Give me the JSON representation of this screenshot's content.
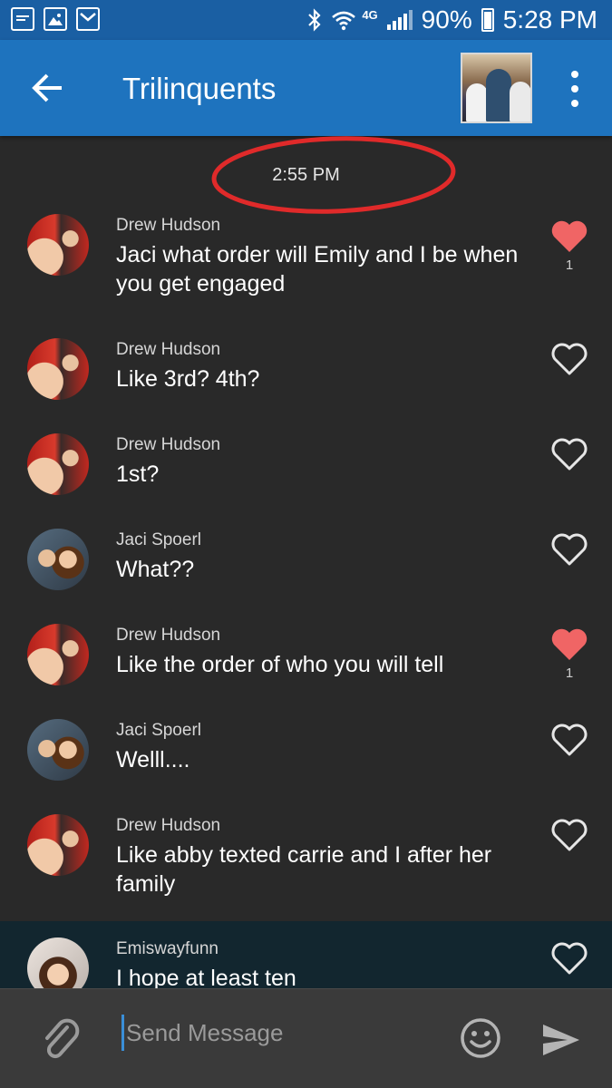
{
  "status_bar": {
    "network": "4G",
    "battery": "90%",
    "time": "5:28 PM"
  },
  "header": {
    "title": "Trilinquents"
  },
  "timestamp": "2:55 PM",
  "messages": [
    {
      "sender": "Drew Hudson",
      "text": "Jaci what order will Emily and I be when you get engaged",
      "liked": true,
      "likes": "1"
    },
    {
      "sender": "Drew Hudson",
      "text": "Like 3rd? 4th?",
      "liked": false,
      "likes": ""
    },
    {
      "sender": "Drew Hudson",
      "text": "1st?",
      "liked": false,
      "likes": ""
    },
    {
      "sender": "Jaci Spoerl",
      "text": "What??",
      "liked": false,
      "likes": ""
    },
    {
      "sender": "Drew Hudson",
      "text": "Like the order of who you will tell",
      "liked": true,
      "likes": "1"
    },
    {
      "sender": "Jaci Spoerl",
      "text": "Welll....",
      "liked": false,
      "likes": ""
    },
    {
      "sender": "Drew Hudson",
      "text": "Like abby texted carrie and I after her family",
      "liked": false,
      "likes": ""
    },
    {
      "sender": "Emiswayfunn",
      "text": "I hope at least ten",
      "liked": false,
      "likes": ""
    }
  ],
  "composer": {
    "placeholder": "Send Message"
  },
  "colors": {
    "status_bar": "#1a5fa3",
    "app_bar": "#1e73be",
    "background": "#292929",
    "heart": "#f06565",
    "annotation_circle": "#e02a2a"
  },
  "icons": [
    "chat-icon",
    "image-icon",
    "mail-icon",
    "bluetooth-icon",
    "wifi-icon",
    "signal-icon",
    "battery-icon",
    "back-arrow-icon",
    "more-vert-icon",
    "heart-icon",
    "paperclip-icon",
    "emoji-icon",
    "send-icon"
  ]
}
